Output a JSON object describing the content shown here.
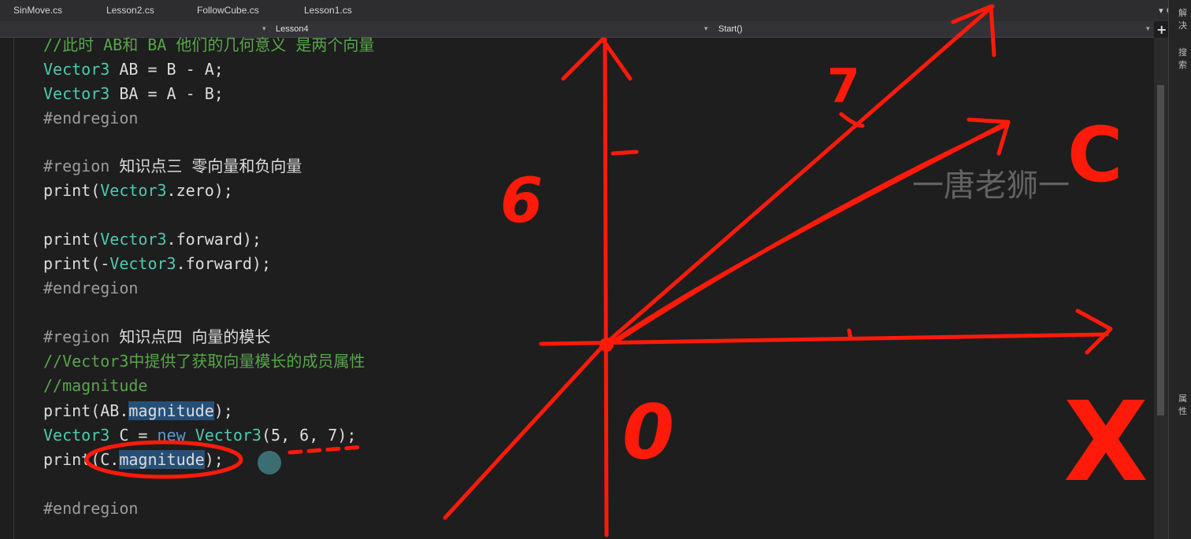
{
  "tabs": [
    "SinMove.cs",
    "Lesson2.cs",
    "FollowCube.cs",
    "Lesson1.cs"
  ],
  "tab_right": "▾ ⚙",
  "nav": {
    "project": "Lesson4",
    "member": "Start()",
    "add": "+"
  },
  "code": {
    "l1": "//此时 AB和 BA 他们的几何意义 是两个向量",
    "l2a": "Vector3",
    "l2b": " AB = B - A;",
    "l3a": "Vector3",
    "l3b": " BA = A - B;",
    "l4": "#endregion",
    "l6a": "#region",
    "l6b": " 知识点三 零向量和负向量",
    "l7a": "print(",
    "l7b": "Vector3",
    "l7c": ".zero);",
    "l9a": "print(",
    "l9b": "Vector3",
    "l9c": ".forward);",
    "l10a": "print(-",
    "l10b": "Vector3",
    "l10c": ".forward);",
    "l11": "#endregion",
    "l13a": "#region",
    "l13b": " 知识点四 向量的模长",
    "l14": "//Vector3中提供了获取向量模长的成员属性",
    "l15": "//magnitude",
    "l16a": "print(AB.",
    "l16b": "magnitude",
    "l16c": ");",
    "l17a": "Vector3",
    "l17b": " C = ",
    "l17c": "new",
    "l17d": " ",
    "l17e": "Vector3",
    "l17f": "(5, 6, 7);",
    "l18a": "print(C.",
    "l18b": "magnitude",
    "l18c": ");",
    "l20": "#endregion"
  },
  "annotations": {
    "y_num": "6",
    "origin": "0",
    "c_label": "C",
    "x_label": "X",
    "seven": "7"
  },
  "watermark": "一唐老狮一",
  "side": {
    "top": "解决",
    "search": "搜索",
    "props": "属性"
  },
  "colors": {
    "ink": "#ff1a0a",
    "keyword": "#569cd6",
    "type": "#4ec9b0",
    "comment": "#57a64a"
  }
}
